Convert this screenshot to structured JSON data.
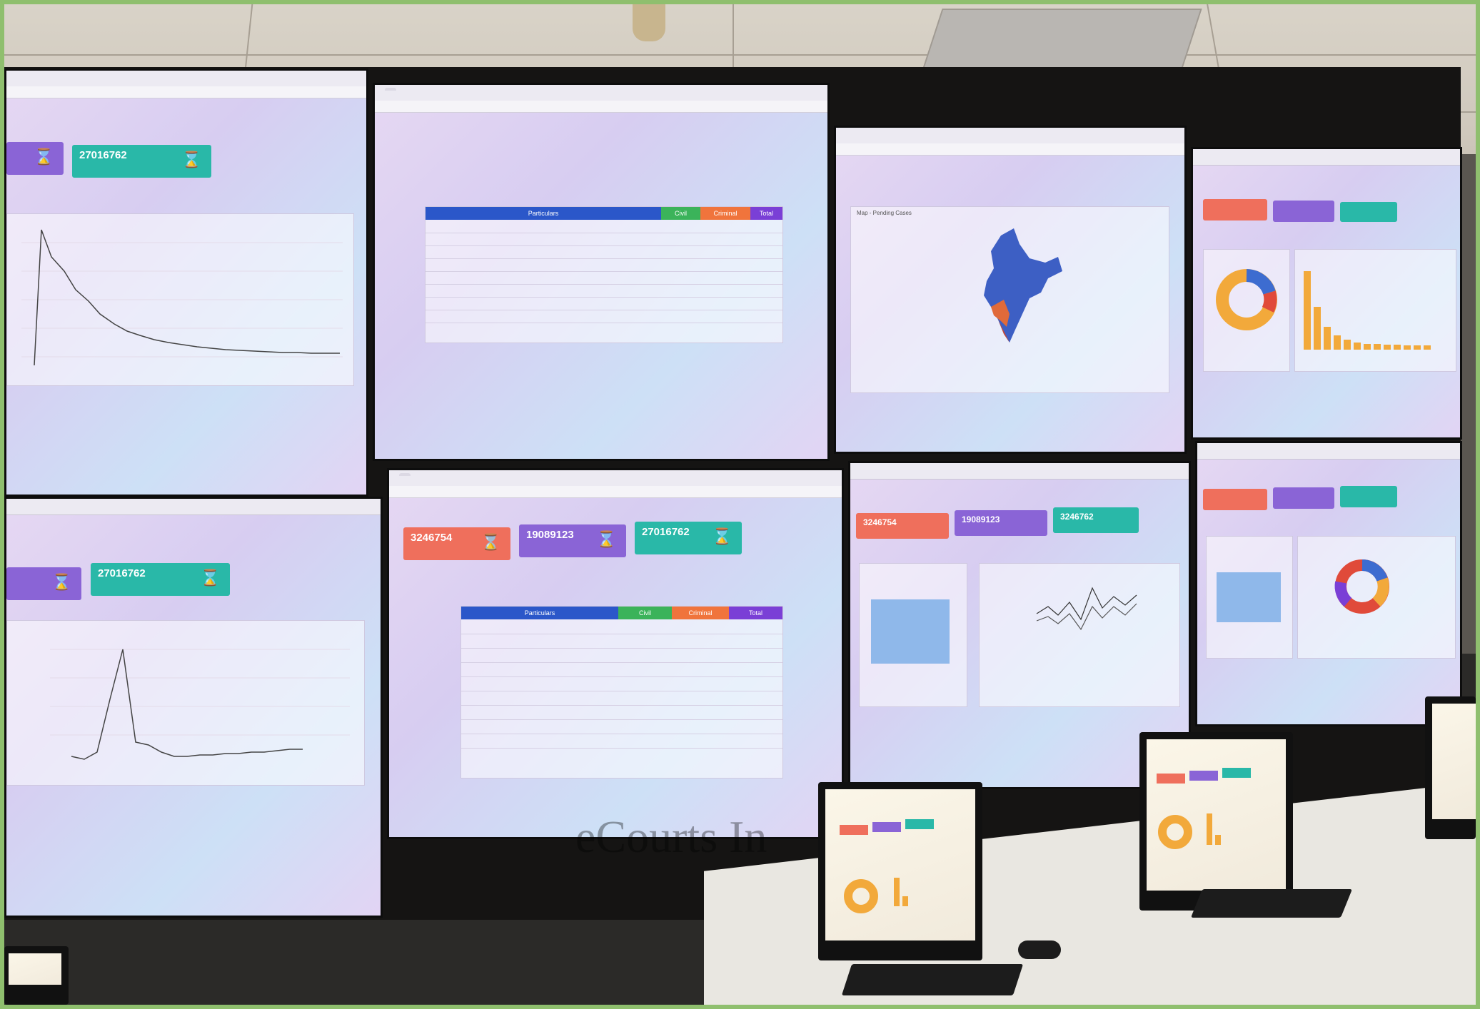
{
  "wall": {
    "panel_a": {
      "tile_value": "27016762"
    },
    "panel_b": {
      "table_headers": [
        "Particulars",
        "Civil",
        "Criminal",
        "Total"
      ]
    },
    "panel_c": {
      "map_title": "Map - Pending Cases"
    },
    "panel_e": {
      "tile_value": "27016762"
    },
    "panel_f": {
      "tiles": [
        {
          "value": "3246754"
        },
        {
          "value": "19089123"
        },
        {
          "value": "27016762"
        }
      ],
      "table_headers": [
        "Particulars",
        "Civil",
        "Criminal",
        "Total"
      ]
    },
    "panel_g": {
      "tiles": [
        {
          "value": "3246754"
        },
        {
          "value": "19089123"
        },
        {
          "value": "3246762"
        }
      ]
    }
  },
  "watermark": "eCourts In",
  "colors": {
    "tile_red": "#ef6f5c",
    "tile_purple": "#8a64d6",
    "tile_teal": "#29b8a8",
    "table_blue": "#2b57c9",
    "table_green": "#3bb35a",
    "table_orange": "#f0743c",
    "table_violet": "#7a3fd6",
    "map_blue": "#3d5fc4"
  },
  "icons": [
    "hourglass-icon",
    "donut-chart-icon",
    "bar-chart-icon",
    "line-chart-icon",
    "india-map-icon"
  ]
}
